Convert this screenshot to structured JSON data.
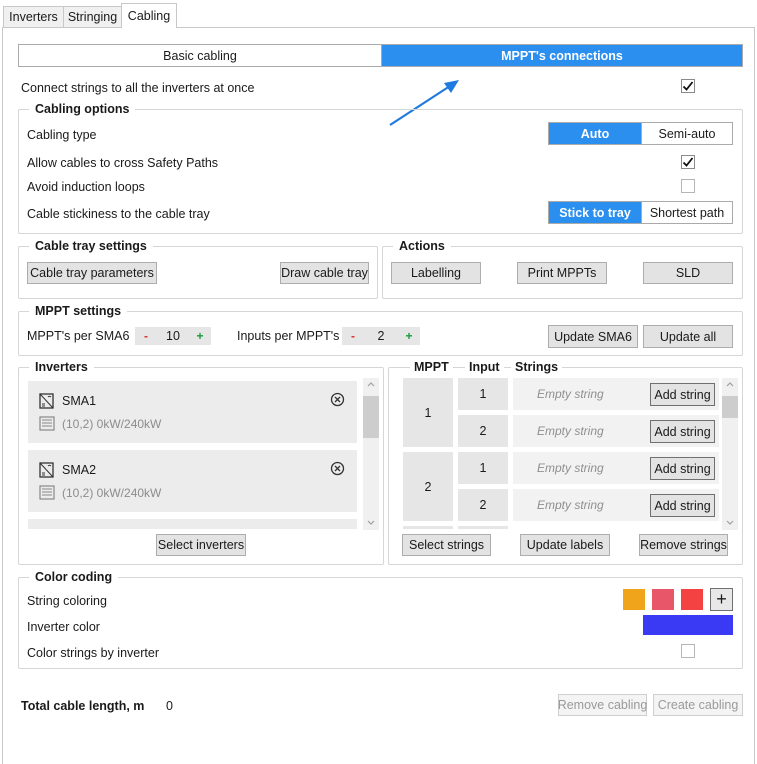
{
  "tabs": [
    {
      "label": "Inverters",
      "active": false
    },
    {
      "label": "Stringing",
      "active": false
    },
    {
      "label": "Cabling",
      "active": true
    }
  ],
  "mode_switch": {
    "basic": "Basic cabling",
    "mppt": "MPPT's connections",
    "selected": "MPPT's connections"
  },
  "connect_all": {
    "label": "Connect strings to all the inverters at once",
    "checked": true
  },
  "cabling_options": {
    "title": "Cabling options",
    "cabling_type": {
      "label": "Cabling type",
      "options": [
        "Auto",
        "Semi-auto"
      ],
      "selected": "Auto"
    },
    "cross_safety": {
      "label": "Allow cables to cross Safety Paths",
      "checked": true
    },
    "induction": {
      "label": "Avoid induction loops",
      "checked": false
    },
    "stickiness": {
      "label": "Cable stickiness to the cable tray",
      "options": [
        "Stick to tray",
        "Shortest path"
      ],
      "selected": "Stick to tray"
    }
  },
  "cable_tray": {
    "title": "Cable tray settings",
    "params_btn": "Cable tray parameters",
    "draw_btn": "Draw cable tray"
  },
  "actions": {
    "title": "Actions",
    "labelling_btn": "Labelling",
    "print_btn": "Print MPPTs",
    "sld_btn": "SLD"
  },
  "mppt_settings": {
    "title": "MPPT settings",
    "per_sma_label": "MPPT's per SMA6",
    "per_sma_value": "10",
    "inputs_label": "Inputs per MPPT's",
    "inputs_value": "2",
    "minus": "-",
    "plus": "+",
    "update_sma_btn": "Update SMA6",
    "update_all_btn": "Update all"
  },
  "inverters": {
    "title": "Inverters",
    "items": [
      {
        "name": "SMA1",
        "info": "(10,2)  0kW/240kW"
      },
      {
        "name": "SMA2",
        "info": "(10,2)  0kW/240kW"
      }
    ],
    "select_btn": "Select inverters"
  },
  "mppt_table": {
    "headers": {
      "mppt": "MPPT",
      "input": "Input",
      "strings": "Strings"
    },
    "rows": [
      {
        "mppt": "1",
        "inputs": [
          {
            "input": "1",
            "string": "Empty string",
            "add": "Add string"
          },
          {
            "input": "2",
            "string": "Empty string",
            "add": "Add string"
          }
        ]
      },
      {
        "mppt": "2",
        "inputs": [
          {
            "input": "1",
            "string": "Empty string",
            "add": "Add string"
          },
          {
            "input": "2",
            "string": "Empty string",
            "add": "Add string"
          }
        ]
      }
    ],
    "select_btn": "Select strings",
    "update_btn": "Update labels",
    "remove_btn": "Remove strings"
  },
  "color_coding": {
    "title": "Color coding",
    "string_label": "String coloring",
    "swatches": [
      "#f0a41c",
      "#e8566a",
      "#f44242"
    ],
    "add_symbol": "+",
    "inverter_label": "Inverter color",
    "inverter_color": "#3a3af5",
    "by_inverter": {
      "label": "Color strings by inverter",
      "checked": false
    }
  },
  "footer": {
    "total_label": "Total cable length, m",
    "total_value": "0",
    "remove_btn": "Remove cabling",
    "create_btn": "Create cabling"
  },
  "colors": {
    "accent": "#2b8ff0",
    "arrow": "#1f7ae0"
  }
}
